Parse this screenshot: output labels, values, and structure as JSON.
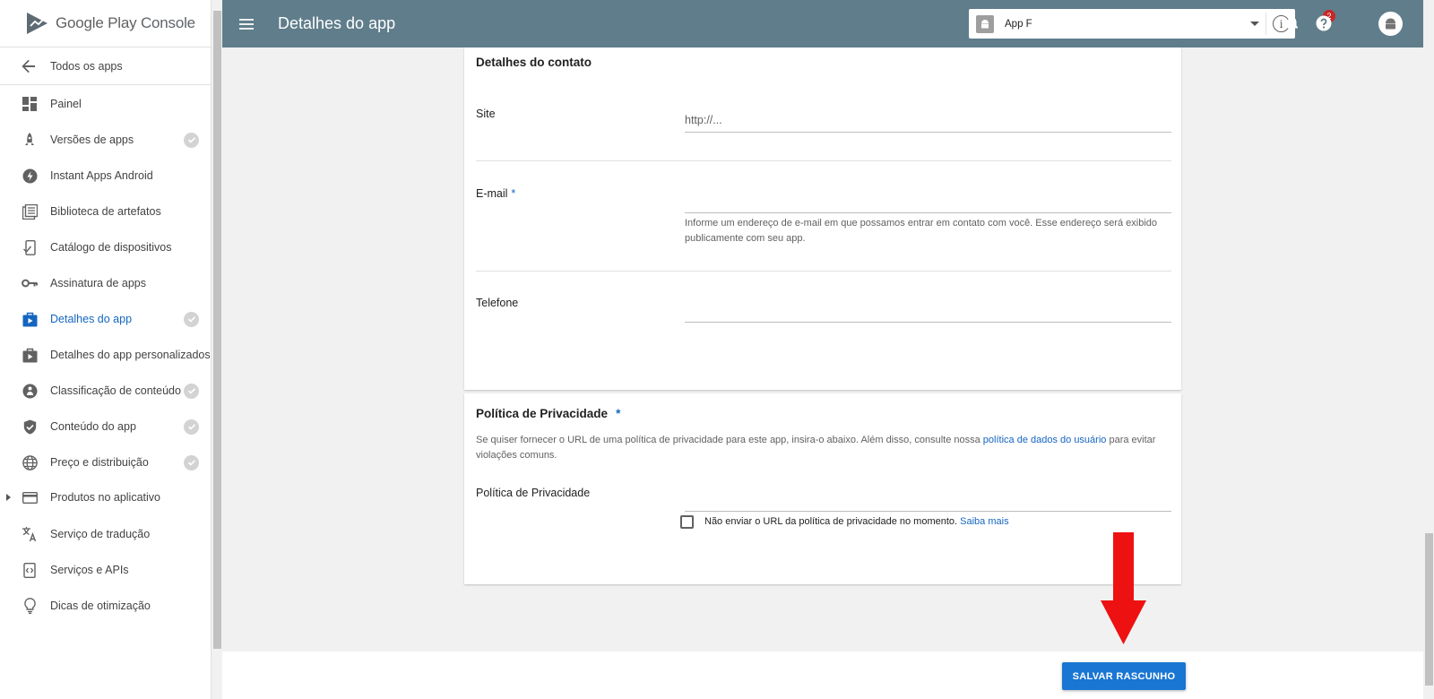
{
  "brand": {
    "name": "Google Play",
    "suffix": "Console"
  },
  "sidebar": {
    "back_label": "Todos os apps",
    "items": [
      {
        "label": "Painel",
        "icon": "dashboard-icon",
        "checked": false
      },
      {
        "label": "Versões de apps",
        "icon": "rocket-icon",
        "checked": true
      },
      {
        "label": "Instant Apps Android",
        "icon": "bolt-icon",
        "checked": false
      },
      {
        "label": "Biblioteca de artefatos",
        "icon": "library-icon",
        "checked": false
      },
      {
        "label": "Catálogo de dispositivos",
        "icon": "device-catalog-icon",
        "checked": false
      },
      {
        "label": "Assinatura de apps",
        "icon": "key-icon",
        "checked": false
      },
      {
        "label": "Detalhes do app",
        "icon": "store-listing-icon",
        "checked": true,
        "active": true
      },
      {
        "label": "Detalhes do app personalizados",
        "icon": "custom-listing-icon",
        "checked": false
      },
      {
        "label": "Classificação de conteúdo",
        "icon": "content-rating-icon",
        "checked": true
      },
      {
        "label": "Conteúdo do app",
        "icon": "shield-icon",
        "checked": true
      },
      {
        "label": "Preço e distribuição",
        "icon": "globe-icon",
        "checked": true
      },
      {
        "label": "Produtos no aplicativo",
        "icon": "credit-card-icon",
        "checked": false,
        "expandable": true
      },
      {
        "label": "Serviço de tradução",
        "icon": "translate-icon",
        "checked": false
      },
      {
        "label": "Serviços e APIs",
        "icon": "api-icon",
        "checked": false
      },
      {
        "label": "Dicas de otimização",
        "icon": "lightbulb-icon",
        "checked": false
      }
    ]
  },
  "header": {
    "title": "Detalhes do app",
    "app_selector": {
      "value": "App F"
    },
    "notifications_count": "2"
  },
  "contact": {
    "title": "Detalhes do contato",
    "site_label": "Site",
    "site_placeholder": "http://...",
    "email_label": "E-mail",
    "email_required": "*",
    "email_help": "Informe um endereço de e-mail em que possamos entrar em contato com você. Esse endereço será exibido publicamente com seu app.",
    "phone_label": "Telefone"
  },
  "privacy": {
    "title": "Política de Privacidade",
    "required": "*",
    "desc_before": "Se quiser fornecer o URL de uma política de privacidade para este app, insira-o abaixo. Além disso, consulte nossa ",
    "desc_link": "política de dados do usuário",
    "desc_after": " para evitar violações comuns.",
    "field_label": "Política de Privacidade",
    "checkbox_label": "Não enviar o URL da política de privacidade no momento.",
    "checkbox_link": "Saiba mais"
  },
  "footer": {
    "save_label": "SALVAR RASCUNHO"
  },
  "colors": {
    "header": "#607d8b",
    "accent": "#1565c0",
    "button": "#1976d2",
    "arrow": "#ee1111"
  }
}
